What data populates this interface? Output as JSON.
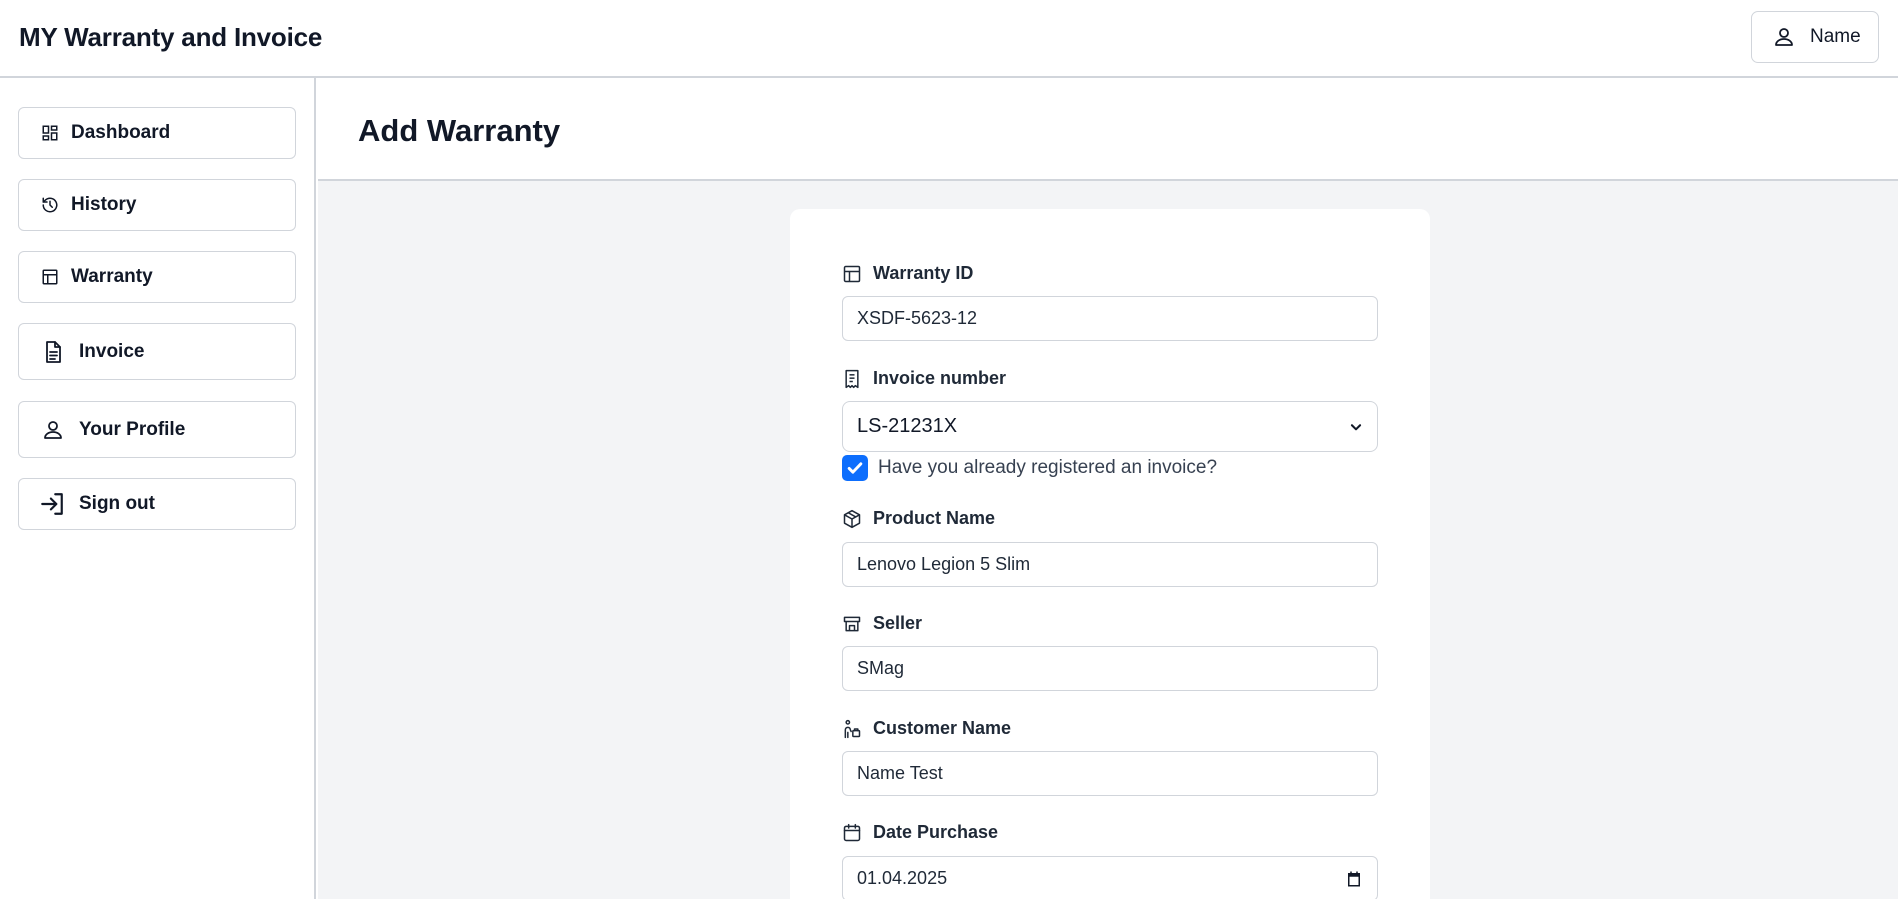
{
  "app": {
    "title": "MY Warranty and Invoice"
  },
  "header": {
    "user_label": "Name"
  },
  "sidebar": {
    "items": [
      {
        "label": "Dashboard",
        "icon": "dashboard-icon"
      },
      {
        "label": "History",
        "icon": "history-icon"
      },
      {
        "label": "Warranty",
        "icon": "warranty-icon"
      },
      {
        "label": "Invoice",
        "icon": "invoice-icon"
      },
      {
        "label": "Your Profile",
        "icon": "user-icon"
      },
      {
        "label": "Sign out",
        "icon": "sign-out-icon"
      }
    ]
  },
  "page": {
    "title": "Add Warranty"
  },
  "form": {
    "warranty_id": {
      "label": "Warranty ID",
      "value": "XSDF-5623-12",
      "icon": "layout-icon"
    },
    "invoice_number": {
      "label": "Invoice number",
      "value": "LS-21231X",
      "icon": "receipt-icon"
    },
    "registered_invoice": {
      "label": "Have you already registered an invoice?",
      "checked": true
    },
    "product_name": {
      "label": "Product Name",
      "value": "Lenovo Legion 5 Slim",
      "icon": "package-icon"
    },
    "seller": {
      "label": "Seller",
      "value": "SMag",
      "icon": "store-icon"
    },
    "customer_name": {
      "label": "Customer Name",
      "value": "Name Test",
      "icon": "customer-icon"
    },
    "date_purchase": {
      "label": "Date Purchase",
      "value": "01.04.2025",
      "icon": "calendar-icon"
    }
  },
  "colors": {
    "accent": "#0d6efd",
    "border": "#d1d5db",
    "main_background": "#f3f4f6",
    "text": "#111827"
  }
}
